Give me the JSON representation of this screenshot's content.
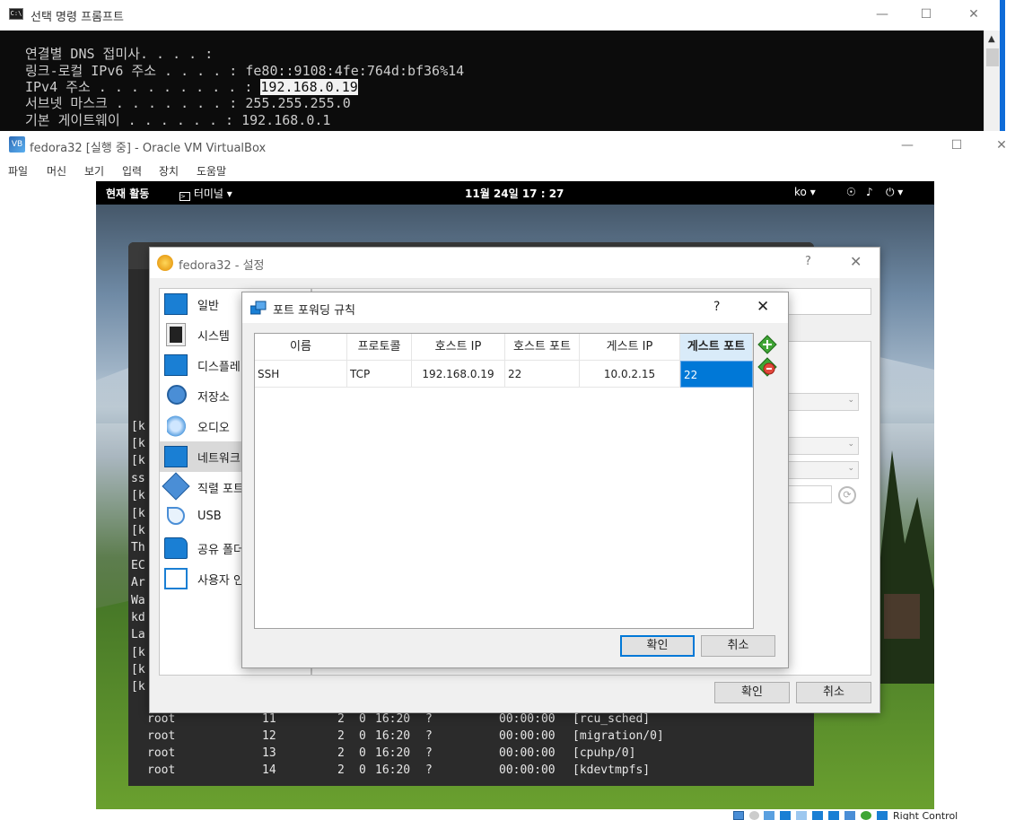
{
  "cmd": {
    "title": "선택 명령 프롬프트",
    "lines": [
      "연결별 DNS 접미사. . . . :",
      "링크-로컬 IPv6 주소 . . . . : fe80::9108:4fe:764d:bf36%14",
      "IPv4 주소 . . . . . . . . . : ",
      "서브넷 마스크 . . . . . . . : 255.255.255.0",
      "기본 게이트웨이 . . . . . . : 192.168.0.1"
    ],
    "ipv4_value": "192.168.0.19"
  },
  "vbox": {
    "title": "fedora32 [실행 중] - Oracle VM VirtualBox",
    "menu": [
      "파일",
      "머신",
      "보기",
      "입력",
      "장치",
      "도움말"
    ],
    "status_text": "Right Control"
  },
  "gnome": {
    "activities": "현재 활동",
    "app": "터미널",
    "clock": "11월 24일 17 : 27",
    "lang": "ko"
  },
  "terminal": {
    "fragments": [
      "[k",
      "[k",
      "[k",
      "ss",
      "[k",
      "[k",
      "[k",
      "Th",
      "EC",
      "Ar",
      "Wa",
      "kd",
      "La",
      "[k",
      "[k",
      "[k"
    ],
    "rows": [
      {
        "user": "root",
        "pid": "11",
        "ppid": "2",
        "c": "0",
        "stime": "16:20",
        "tty": "?",
        "time": "00:00:00",
        "cmd": "[rcu_sched]"
      },
      {
        "user": "root",
        "pid": "12",
        "ppid": "2",
        "c": "0",
        "stime": "16:20",
        "tty": "?",
        "time": "00:00:00",
        "cmd": "[migration/0]"
      },
      {
        "user": "root",
        "pid": "13",
        "ppid": "2",
        "c": "0",
        "stime": "16:20",
        "tty": "?",
        "time": "00:00:00",
        "cmd": "[cpuhp/0]"
      },
      {
        "user": "root",
        "pid": "14",
        "ppid": "2",
        "c": "0",
        "stime": "16:20",
        "tty": "?",
        "time": "00:00:00",
        "cmd": "[kdevtmpfs]"
      }
    ]
  },
  "settings": {
    "title": "fedora32 - 설정",
    "help": "?",
    "nav": [
      {
        "label": "일반",
        "icon": "general-icon"
      },
      {
        "label": "시스템",
        "icon": "system-icon"
      },
      {
        "label": "디스플레",
        "icon": "display-icon"
      },
      {
        "label": "저장소",
        "icon": "storage-icon"
      },
      {
        "label": "오디오",
        "icon": "audio-icon"
      },
      {
        "label": "네트워크",
        "icon": "network-icon"
      },
      {
        "label": "직렬 포트",
        "icon": "serial-port-icon"
      },
      {
        "label": "USB",
        "icon": "usb-icon"
      },
      {
        "label": "공유 폴더",
        "icon": "shared-folder-icon"
      },
      {
        "label": "사용자 인",
        "icon": "user-interface-icon"
      }
    ],
    "selected_nav": "네트워크",
    "ok_label": "확인",
    "cancel_label": "취소"
  },
  "port_forwarding": {
    "title": "포트 포워딩 규칙",
    "help": "?",
    "columns": [
      "이름",
      "프로토콜",
      "호스트 IP",
      "호스트 포트",
      "게스트 IP",
      "게스트 포트"
    ],
    "rows": [
      {
        "name": "SSH",
        "protocol": "TCP",
        "host_ip": "192.168.0.19",
        "host_port": "22",
        "guest_ip": "10.0.2.15",
        "guest_port": "22"
      }
    ],
    "ok_label": "확인",
    "cancel_label": "취소"
  },
  "colors": {
    "selection_blue": "#0078d7",
    "console_bg": "#0c0c0c",
    "gnome_bar": "#000000"
  }
}
